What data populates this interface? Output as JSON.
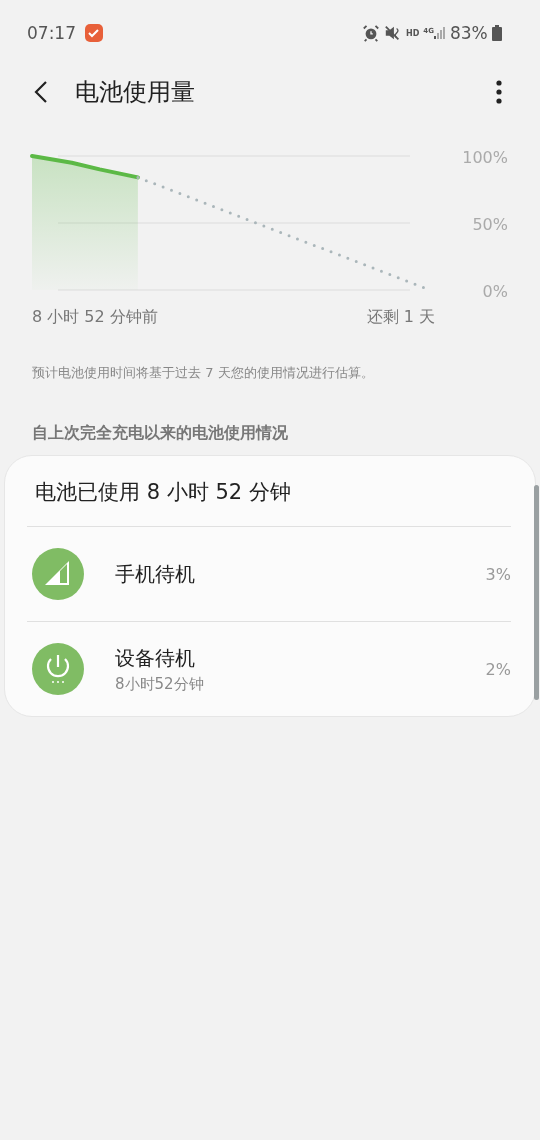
{
  "status_bar": {
    "time": "07:17",
    "hd": "HD",
    "network": "4G",
    "battery": "83%"
  },
  "header": {
    "title": "电池使用量"
  },
  "chart": {
    "y_labels": [
      "100%",
      "50%",
      "0%"
    ],
    "start_label": "8 小时 52 分钟前",
    "end_label": "还剩 1 天"
  },
  "note": "预计电池使用时间将基于过去 7 天您的使用情况进行估算。",
  "section_title": "自上次完全充电以来的电池使用情况",
  "usage": {
    "title": "电池已使用 8 小时 52 分钟",
    "items": [
      {
        "kind": "signal",
        "name": "手机待机",
        "percent": "3%"
      },
      {
        "kind": "power",
        "name": "设备待机",
        "detail": "8小时52分钟",
        "percent": "2%"
      }
    ]
  }
}
